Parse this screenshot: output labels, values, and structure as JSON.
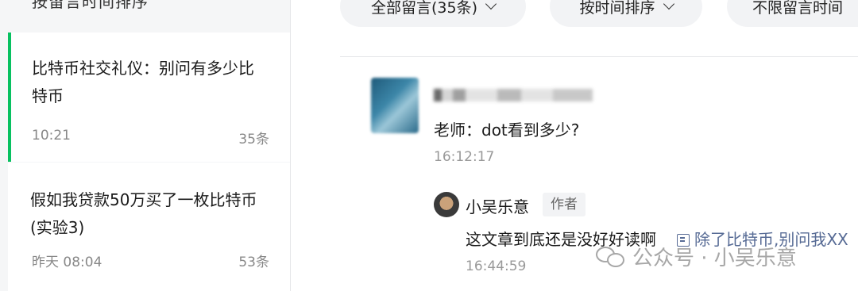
{
  "sidebar": {
    "top_partial_text": "按留言时间排序",
    "items": [
      {
        "title": "比特币社交礼仪：别问有多少比特币",
        "time": "10:21",
        "count": "35条",
        "active": true
      },
      {
        "title": "假如我贷款50万买了一枚比特币(实验3)",
        "time": "昨天 08:04",
        "count": "53条",
        "active": false
      }
    ]
  },
  "filters": [
    {
      "label": "全部留言(35条)"
    },
    {
      "label": "按时间排序"
    },
    {
      "label": "不限留言时间"
    }
  ],
  "comment": {
    "text": "老师：dot看到多少?",
    "time": "16:12:17",
    "reply": {
      "author": "小吴乐意",
      "badge": "作者",
      "text": "这文章到底还是没好好读啊",
      "link_text": "除了比特币,别问我XX",
      "time": "16:44:59"
    }
  },
  "watermark": {
    "text": "公众号 · 小吴乐意",
    "icon": "wechat-icon"
  },
  "colors": {
    "accent": "#07c160",
    "link": "#576b95"
  }
}
